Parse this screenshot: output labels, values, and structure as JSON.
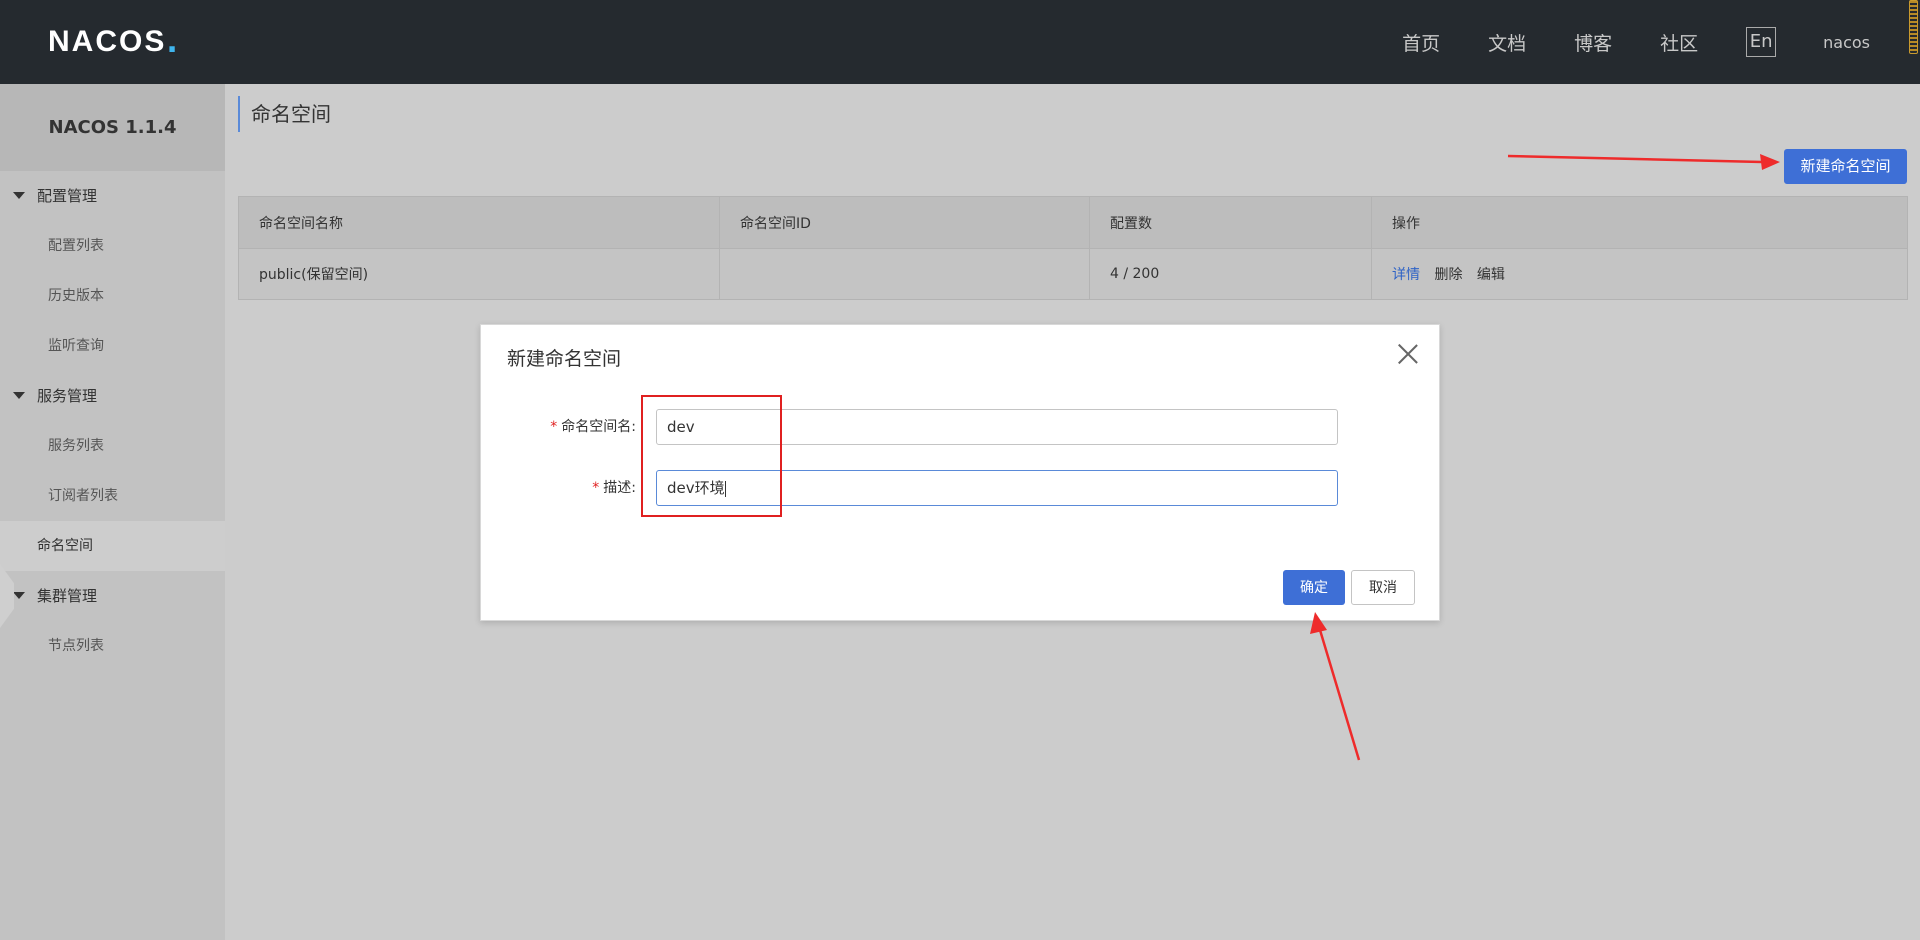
{
  "header": {
    "logo": "NACOS",
    "nav": [
      {
        "label": "首页"
      },
      {
        "label": "文档"
      },
      {
        "label": "博客"
      },
      {
        "label": "社区"
      }
    ],
    "lang": "En",
    "user": "nacos"
  },
  "sidebar": {
    "title": "NACOS 1.1.4",
    "groups": [
      {
        "label": "配置管理",
        "items": [
          "配置列表",
          "历史版本",
          "监听查询"
        ]
      },
      {
        "label": "服务管理",
        "items": [
          "服务列表",
          "订阅者列表"
        ]
      },
      {
        "active": "命名空间"
      },
      {
        "label": "集群管理",
        "items": [
          "节点列表"
        ]
      }
    ]
  },
  "page": {
    "title": "命名空间",
    "create_label": "新建命名空间"
  },
  "table": {
    "columns": [
      "命名空间名称",
      "命名空间ID",
      "配置数",
      "操作"
    ],
    "rows": [
      {
        "name": "public(保留空间)",
        "id": "",
        "count": "4 / 200",
        "ops": [
          "详情",
          "删除",
          "编辑"
        ]
      }
    ]
  },
  "dialog": {
    "title": "新建命名空间",
    "fields": [
      {
        "label": "命名空间名:",
        "value": "dev"
      },
      {
        "label": "描述:",
        "value": "dev环境"
      }
    ],
    "ok_label": "确定",
    "cancel_label": "取消"
  },
  "colors": {
    "primary": "#3e6fd6",
    "header_bg": "#252a2f",
    "annotation": "#e02020"
  }
}
